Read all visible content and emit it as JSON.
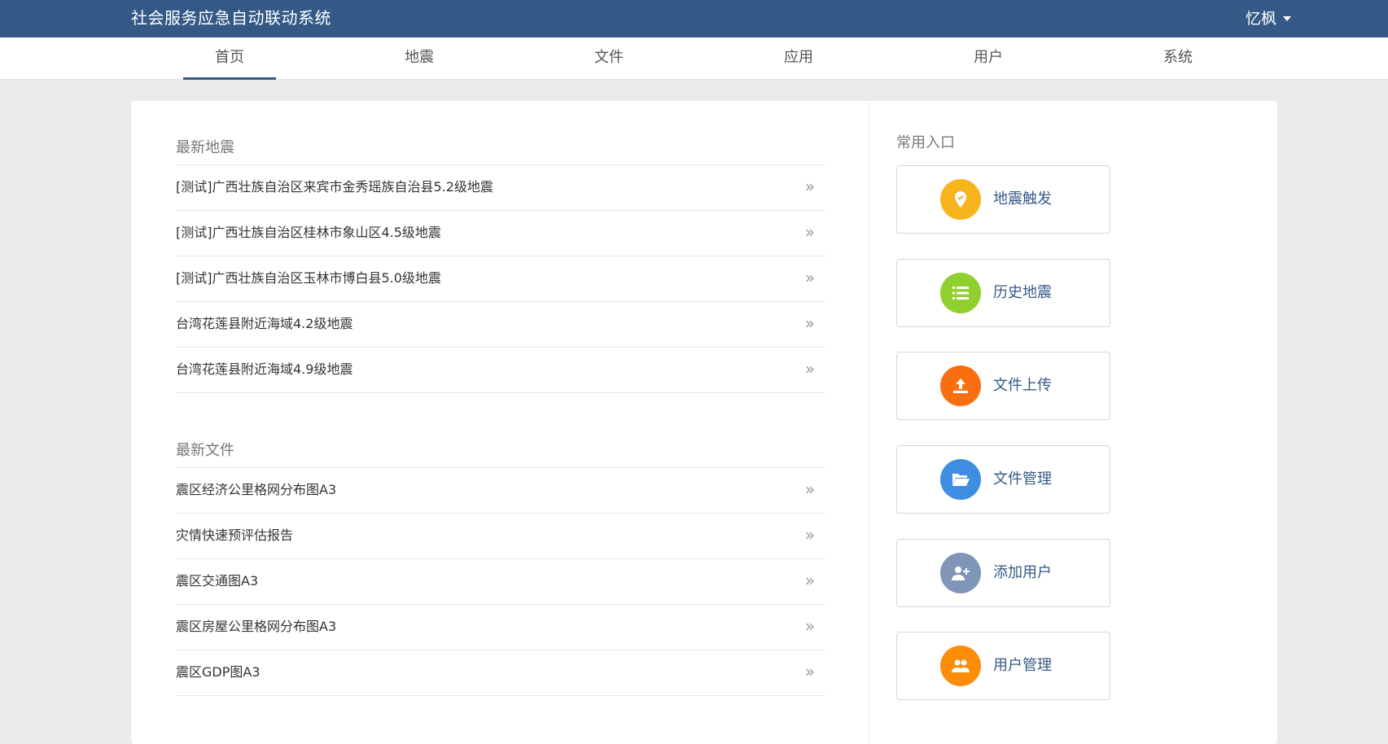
{
  "header": {
    "app_title": "社会服务应急自动联动系统",
    "user_name": "忆枫"
  },
  "nav": {
    "tabs": [
      {
        "label": "首页",
        "active": true
      },
      {
        "label": "地震",
        "active": false
      },
      {
        "label": "文件",
        "active": false
      },
      {
        "label": "应用",
        "active": false
      },
      {
        "label": "用户",
        "active": false
      },
      {
        "label": "系统",
        "active": false
      }
    ]
  },
  "latest_earthquakes": {
    "title": "最新地震",
    "items": [
      {
        "label": "[测试]广西壮族自治区来宾市金秀瑶族自治县5.2级地震",
        "arrow": "»"
      },
      {
        "label": "[测试]广西壮族自治区桂林市象山区4.5级地震",
        "arrow": "»"
      },
      {
        "label": "[测试]广西壮族自治区玉林市博白县5.0级地震",
        "arrow": "»"
      },
      {
        "label": "台湾花莲县附近海域4.2级地震",
        "arrow": "»"
      },
      {
        "label": "台湾花莲县附近海域4.9级地震",
        "arrow": "»"
      }
    ]
  },
  "latest_files": {
    "title": "最新文件",
    "items": [
      {
        "label": "震区经济公里格网分布图A3",
        "arrow": "»"
      },
      {
        "label": "灾情快速预评估报告",
        "arrow": "»"
      },
      {
        "label": "震区交通图A3",
        "arrow": "»"
      },
      {
        "label": "震区房屋公里格网分布图A3",
        "arrow": "»"
      },
      {
        "label": "震区GDP图A3",
        "arrow": "»"
      }
    ]
  },
  "quick_entries": {
    "title": "常用入口",
    "items": [
      {
        "label": "地震触发",
        "icon": "location-pin-icon",
        "color": "#f6b51d"
      },
      {
        "label": "历史地震",
        "icon": "list-icon",
        "color": "#8fcf2e"
      },
      {
        "label": "文件上传",
        "icon": "upload-icon",
        "color": "#fa6e12"
      },
      {
        "label": "文件管理",
        "icon": "folder-open-icon",
        "color": "#3f8de3"
      },
      {
        "label": "添加用户",
        "icon": "add-user-icon",
        "color": "#7f96b8"
      },
      {
        "label": "用户管理",
        "icon": "users-icon",
        "color": "#fb8d0b"
      }
    ]
  }
}
